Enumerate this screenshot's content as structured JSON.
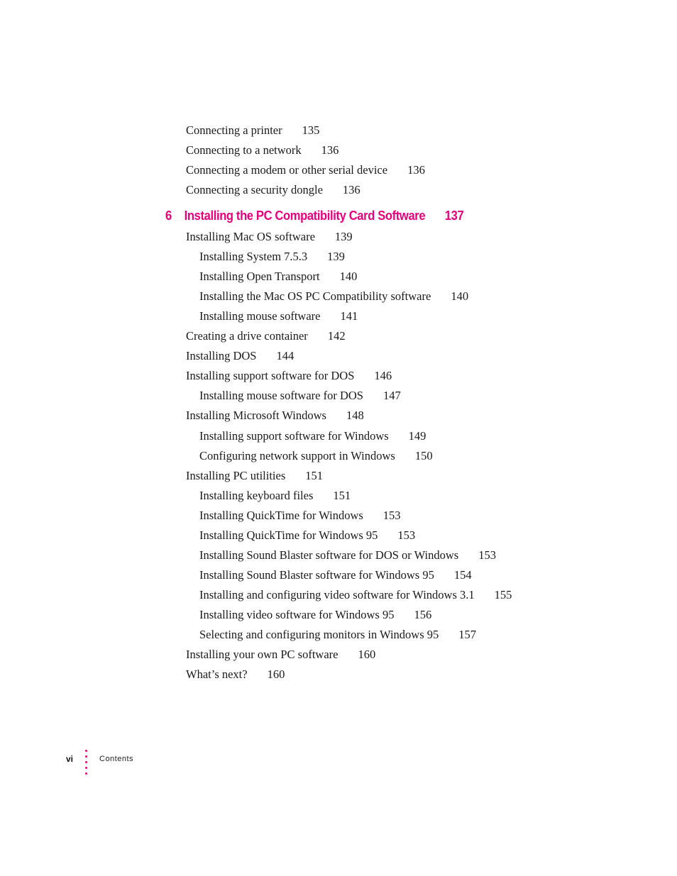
{
  "pre_entries": [
    {
      "title": "Connecting a printer",
      "page": "135",
      "level": 1
    },
    {
      "title": "Connecting to a network",
      "page": "136",
      "level": 1
    },
    {
      "title": "Connecting a modem or other serial device",
      "page": "136",
      "level": 1
    },
    {
      "title": "Connecting a security dongle",
      "page": "136",
      "level": 1
    }
  ],
  "chapter": {
    "number": "6",
    "title": "Installing the PC Compatibility Card Software",
    "page": "137",
    "color": "#e6007e"
  },
  "entries": [
    {
      "title": "Installing Mac OS software",
      "page": "139",
      "level": 1
    },
    {
      "title": "Installing System 7.5.3",
      "page": "139",
      "level": 2
    },
    {
      "title": "Installing Open Transport",
      "page": "140",
      "level": 2
    },
    {
      "title": "Installing the Mac OS PC Compatibility software",
      "page": "140",
      "level": 2
    },
    {
      "title": "Installing mouse software",
      "page": "141",
      "level": 2
    },
    {
      "title": "Creating a drive container",
      "page": "142",
      "level": 1
    },
    {
      "title": "Installing DOS",
      "page": "144",
      "level": 1
    },
    {
      "title": "Installing support software for DOS",
      "page": "146",
      "level": 1
    },
    {
      "title": "Installing mouse software for DOS",
      "page": "147",
      "level": 2
    },
    {
      "title": "Installing Microsoft Windows",
      "page": "148",
      "level": 1
    },
    {
      "title": "Installing support software for Windows",
      "page": "149",
      "level": 2
    },
    {
      "title": "Configuring network support in Windows",
      "page": "150",
      "level": 2
    },
    {
      "title": "Installing PC utilities",
      "page": "151",
      "level": 1
    },
    {
      "title": "Installing keyboard files",
      "page": "151",
      "level": 2
    },
    {
      "title": "Installing QuickTime for Windows",
      "page": "153",
      "level": 2
    },
    {
      "title": "Installing QuickTime for Windows 95",
      "page": "153",
      "level": 2
    },
    {
      "title": "Installing Sound Blaster software for DOS or Windows",
      "page": "153",
      "level": 2
    },
    {
      "title": "Installing Sound Blaster software for Windows 95",
      "page": "154",
      "level": 2
    },
    {
      "title": "Installing and configuring video software for Windows 3.1",
      "page": "155",
      "level": 2
    },
    {
      "title": "Installing video software for Windows 95",
      "page": "156",
      "level": 2
    },
    {
      "title": "Selecting and configuring monitors in Windows 95",
      "page": "157",
      "level": 2
    },
    {
      "title": "Installing your own PC software",
      "page": "160",
      "level": 1
    },
    {
      "title": "What’s next?",
      "page": "160",
      "level": 1
    }
  ],
  "footer": {
    "folio": "vi",
    "section": "Contents"
  }
}
